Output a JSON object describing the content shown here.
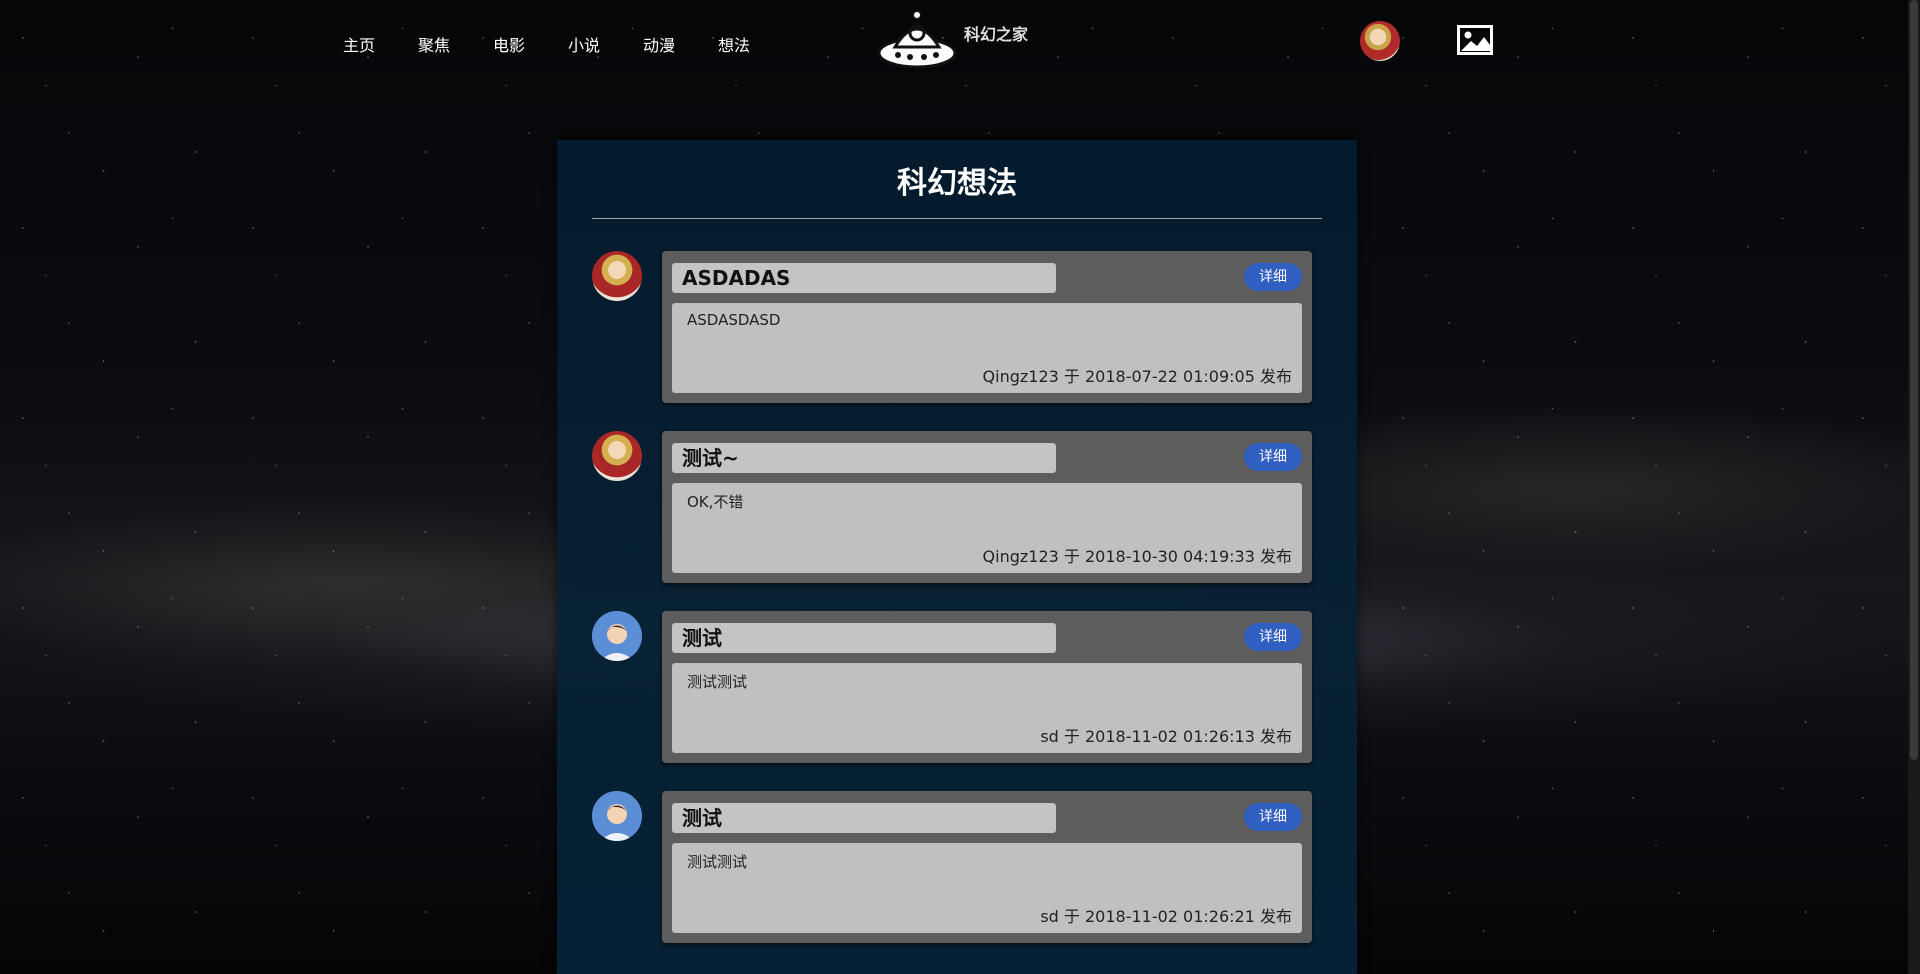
{
  "nav": {
    "links": [
      "主页",
      "聚焦",
      "电影",
      "小说",
      "动漫",
      "想法"
    ],
    "logo_text": "科幻之家"
  },
  "panel": {
    "title": "科幻想法"
  },
  "posts": [
    {
      "avatar": "user-avatar-anime",
      "title": "ASDADAS",
      "detail_label": "详细",
      "content": "ASDASDASD",
      "meta": "Qingz123 于 2018-07-22 01:09:05 发布"
    },
    {
      "avatar": "user-avatar-anime",
      "title": "测试~",
      "detail_label": "详细",
      "content": "OK,不错",
      "meta": "Qingz123 于 2018-10-30 04:19:33 发布"
    },
    {
      "avatar": "user-avatar-boy",
      "title": "测试",
      "detail_label": "详细",
      "content": "测试测试",
      "meta": "sd 于 2018-11-02 01:26:13 发布"
    },
    {
      "avatar": "user-avatar-boy",
      "title": "测试",
      "detail_label": "详细",
      "content": "测试测试",
      "meta": "sd 于 2018-11-02 01:26:21 发布"
    }
  ],
  "colors": {
    "panel_bg": "#062438",
    "card_bg": "#5d5d5d",
    "detail_button": "#2f5fc0"
  }
}
